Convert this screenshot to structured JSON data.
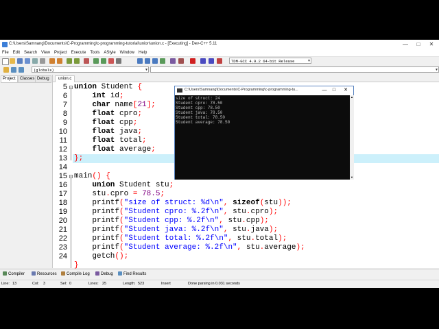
{
  "window": {
    "title": "C:\\Users\\Samnang\\Documents\\C-Programming\\c-programming-tutorial\\union\\union.c - [Executing] - Dev-C++ 5.11",
    "minimize": "—",
    "maximize": "□",
    "close": "✕"
  },
  "menu": [
    "File",
    "Edit",
    "Search",
    "View",
    "Project",
    "Execute",
    "Tools",
    "AStyle",
    "Window",
    "Help"
  ],
  "toolbar": {
    "compiler": "TDM-GCC 4.9.2 64-bit Release",
    "scope": "(globals)"
  },
  "left_panel": {
    "tabs": [
      "Project",
      "Classes",
      "Debug"
    ]
  },
  "editor": {
    "tab": "union.c",
    "line_numbers": [
      "5",
      "6",
      "7",
      "8",
      "9",
      "10",
      "11",
      "12",
      "13",
      "14",
      "15",
      "16",
      "17",
      "18",
      "19",
      "20",
      "21",
      "22",
      "23",
      "24"
    ],
    "current_line": "13"
  },
  "console": {
    "title": "C:\\Users\\Samnang\\Documents\\C-Programming\\c-programming-tu...",
    "lines": [
      "size of struct: 24",
      "Student cpro: 78.50",
      "Student cpp: 78.50",
      "Student java: 78.50",
      "Student total: 78.50",
      "Student average: 78.50"
    ]
  },
  "bottom_tabs": [
    "Compiler",
    "Resources",
    "Compile Log",
    "Debug",
    "Find Results"
  ],
  "status": {
    "line_label": "Line:",
    "line": "13",
    "col_label": "Col:",
    "col": "3",
    "sel_label": "Sel:",
    "sel": "0",
    "lines_label": "Lines:",
    "lines": "25",
    "length_label": "Length:",
    "length": "523",
    "mode": "Insert",
    "message": "Done parsing in 0.031 seconds"
  },
  "colors": {
    "current_line_bg": "#ccf0fb",
    "string": "#0000ff",
    "number": "#800080",
    "symbol": "#ff0000",
    "console_bg": "#0c0c0c",
    "console_text": "#c0c0c0"
  }
}
